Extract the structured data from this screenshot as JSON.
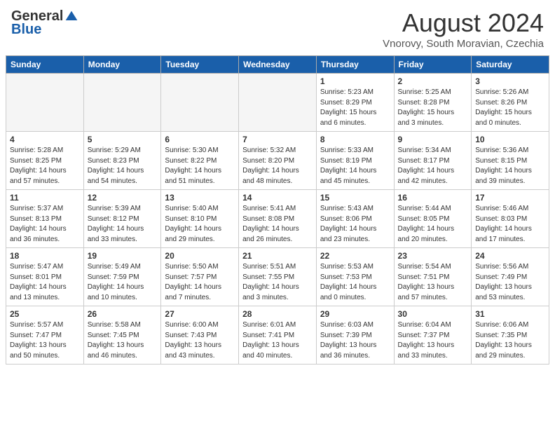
{
  "header": {
    "logo_general": "General",
    "logo_blue": "Blue",
    "month_year": "August 2024",
    "location": "Vnorovy, South Moravian, Czechia"
  },
  "days_of_week": [
    "Sunday",
    "Monday",
    "Tuesday",
    "Wednesday",
    "Thursday",
    "Friday",
    "Saturday"
  ],
  "weeks": [
    [
      {
        "day": "",
        "empty": true
      },
      {
        "day": "",
        "empty": true
      },
      {
        "day": "",
        "empty": true
      },
      {
        "day": "",
        "empty": true
      },
      {
        "day": "1",
        "sunrise": "5:23 AM",
        "sunset": "8:29 PM",
        "daylight": "15 hours and 6 minutes."
      },
      {
        "day": "2",
        "sunrise": "5:25 AM",
        "sunset": "8:28 PM",
        "daylight": "15 hours and 3 minutes."
      },
      {
        "day": "3",
        "sunrise": "5:26 AM",
        "sunset": "8:26 PM",
        "daylight": "15 hours and 0 minutes."
      }
    ],
    [
      {
        "day": "4",
        "sunrise": "5:28 AM",
        "sunset": "8:25 PM",
        "daylight": "14 hours and 57 minutes."
      },
      {
        "day": "5",
        "sunrise": "5:29 AM",
        "sunset": "8:23 PM",
        "daylight": "14 hours and 54 minutes."
      },
      {
        "day": "6",
        "sunrise": "5:30 AM",
        "sunset": "8:22 PM",
        "daylight": "14 hours and 51 minutes."
      },
      {
        "day": "7",
        "sunrise": "5:32 AM",
        "sunset": "8:20 PM",
        "daylight": "14 hours and 48 minutes."
      },
      {
        "day": "8",
        "sunrise": "5:33 AM",
        "sunset": "8:19 PM",
        "daylight": "14 hours and 45 minutes."
      },
      {
        "day": "9",
        "sunrise": "5:34 AM",
        "sunset": "8:17 PM",
        "daylight": "14 hours and 42 minutes."
      },
      {
        "day": "10",
        "sunrise": "5:36 AM",
        "sunset": "8:15 PM",
        "daylight": "14 hours and 39 minutes."
      }
    ],
    [
      {
        "day": "11",
        "sunrise": "5:37 AM",
        "sunset": "8:13 PM",
        "daylight": "14 hours and 36 minutes."
      },
      {
        "day": "12",
        "sunrise": "5:39 AM",
        "sunset": "8:12 PM",
        "daylight": "14 hours and 33 minutes."
      },
      {
        "day": "13",
        "sunrise": "5:40 AM",
        "sunset": "8:10 PM",
        "daylight": "14 hours and 29 minutes."
      },
      {
        "day": "14",
        "sunrise": "5:41 AM",
        "sunset": "8:08 PM",
        "daylight": "14 hours and 26 minutes."
      },
      {
        "day": "15",
        "sunrise": "5:43 AM",
        "sunset": "8:06 PM",
        "daylight": "14 hours and 23 minutes."
      },
      {
        "day": "16",
        "sunrise": "5:44 AM",
        "sunset": "8:05 PM",
        "daylight": "14 hours and 20 minutes."
      },
      {
        "day": "17",
        "sunrise": "5:46 AM",
        "sunset": "8:03 PM",
        "daylight": "14 hours and 17 minutes."
      }
    ],
    [
      {
        "day": "18",
        "sunrise": "5:47 AM",
        "sunset": "8:01 PM",
        "daylight": "14 hours and 13 minutes."
      },
      {
        "day": "19",
        "sunrise": "5:49 AM",
        "sunset": "7:59 PM",
        "daylight": "14 hours and 10 minutes."
      },
      {
        "day": "20",
        "sunrise": "5:50 AM",
        "sunset": "7:57 PM",
        "daylight": "14 hours and 7 minutes."
      },
      {
        "day": "21",
        "sunrise": "5:51 AM",
        "sunset": "7:55 PM",
        "daylight": "14 hours and 3 minutes."
      },
      {
        "day": "22",
        "sunrise": "5:53 AM",
        "sunset": "7:53 PM",
        "daylight": "14 hours and 0 minutes."
      },
      {
        "day": "23",
        "sunrise": "5:54 AM",
        "sunset": "7:51 PM",
        "daylight": "13 hours and 57 minutes."
      },
      {
        "day": "24",
        "sunrise": "5:56 AM",
        "sunset": "7:49 PM",
        "daylight": "13 hours and 53 minutes."
      }
    ],
    [
      {
        "day": "25",
        "sunrise": "5:57 AM",
        "sunset": "7:47 PM",
        "daylight": "13 hours and 50 minutes."
      },
      {
        "day": "26",
        "sunrise": "5:58 AM",
        "sunset": "7:45 PM",
        "daylight": "13 hours and 46 minutes."
      },
      {
        "day": "27",
        "sunrise": "6:00 AM",
        "sunset": "7:43 PM",
        "daylight": "13 hours and 43 minutes."
      },
      {
        "day": "28",
        "sunrise": "6:01 AM",
        "sunset": "7:41 PM",
        "daylight": "13 hours and 40 minutes."
      },
      {
        "day": "29",
        "sunrise": "6:03 AM",
        "sunset": "7:39 PM",
        "daylight": "13 hours and 36 minutes."
      },
      {
        "day": "30",
        "sunrise": "6:04 AM",
        "sunset": "7:37 PM",
        "daylight": "13 hours and 33 minutes."
      },
      {
        "day": "31",
        "sunrise": "6:06 AM",
        "sunset": "7:35 PM",
        "daylight": "13 hours and 29 minutes."
      }
    ]
  ]
}
